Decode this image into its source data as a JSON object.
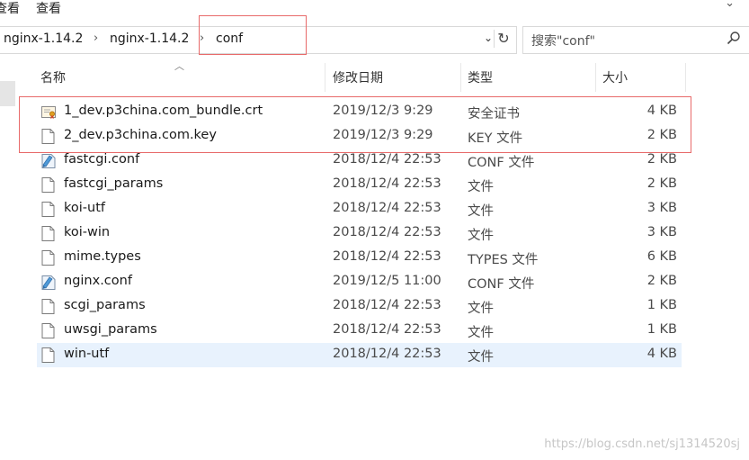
{
  "ribbon": {
    "menu_left": "查看",
    "menu_view": "查看",
    "expand_icon": "chevron-down-icon"
  },
  "address": {
    "crumbs": [
      "nginx-1.14.2",
      "nginx-1.14.2",
      "conf"
    ],
    "separator": "›",
    "dropdown_glyph": "⌄",
    "refresh_glyph": "↻"
  },
  "search": {
    "placeholder": "搜索\"conf\"",
    "icon_glyph": "⚲"
  },
  "columns": {
    "name": "名称",
    "modified": "修改日期",
    "type": "类型",
    "size": "大小"
  },
  "files": [
    {
      "name": "1_dev.p3china.com_bundle.crt",
      "modified": "2019/12/3 9:29",
      "type": "安全证书",
      "size": "4 KB",
      "icon": "certificate-icon"
    },
    {
      "name": "2_dev.p3china.com.key",
      "modified": "2019/12/3 9:29",
      "type": "KEY 文件",
      "size": "2 KB",
      "icon": "file-icon"
    },
    {
      "name": "fastcgi.conf",
      "modified": "2018/12/4 22:53",
      "type": "CONF 文件",
      "size": "2 KB",
      "icon": "conf-file-icon"
    },
    {
      "name": "fastcgi_params",
      "modified": "2018/12/4 22:53",
      "type": "文件",
      "size": "2 KB",
      "icon": "file-icon"
    },
    {
      "name": "koi-utf",
      "modified": "2018/12/4 22:53",
      "type": "文件",
      "size": "3 KB",
      "icon": "file-icon"
    },
    {
      "name": "koi-win",
      "modified": "2018/12/4 22:53",
      "type": "文件",
      "size": "3 KB",
      "icon": "file-icon"
    },
    {
      "name": "mime.types",
      "modified": "2018/12/4 22:53",
      "type": "TYPES 文件",
      "size": "6 KB",
      "icon": "file-icon"
    },
    {
      "name": "nginx.conf",
      "modified": "2019/12/5 11:00",
      "type": "CONF 文件",
      "size": "2 KB",
      "icon": "conf-file-icon"
    },
    {
      "name": "scgi_params",
      "modified": "2018/12/4 22:53",
      "type": "文件",
      "size": "1 KB",
      "icon": "file-icon"
    },
    {
      "name": "uwsgi_params",
      "modified": "2018/12/4 22:53",
      "type": "文件",
      "size": "1 KB",
      "icon": "file-icon"
    },
    {
      "name": "win-utf",
      "modified": "2018/12/4 22:53",
      "type": "文件",
      "size": "4 KB",
      "icon": "file-icon"
    }
  ],
  "selected_index": 10,
  "colors": {
    "selection": "#e8f2fd",
    "annotation_red": "#e86a6a"
  },
  "watermark": "https://blog.csdn.net/sj1314520sj"
}
